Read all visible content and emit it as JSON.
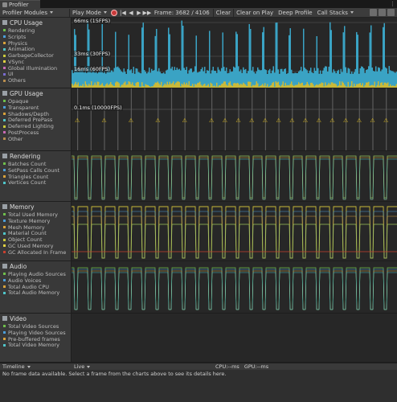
{
  "window": {
    "tab_label": "Profiler",
    "menu_glyph": "⋮"
  },
  "toolbar": {
    "modules_label": "Profiler Modules",
    "playmode_label": "Play Mode",
    "frame_label": "Frame: 3682 / 4106",
    "clear_label": "Clear",
    "clear_on_play_label": "Clear on Play",
    "deep_profile_label": "Deep Profile",
    "call_stacks_label": "Call Stacks",
    "prev_glyph": "◀",
    "next_glyph": "▶",
    "first_glyph": "|◀",
    "last_glyph": "▶▶"
  },
  "modules": [
    {
      "title": "CPU Usage",
      "icon": "cpu-icon",
      "items": [
        {
          "label": "Rendering",
          "color": "#6fbf4c"
        },
        {
          "label": "Scripts",
          "color": "#4c9ed9"
        },
        {
          "label": "Physics",
          "color": "#d9a23a"
        },
        {
          "label": "Animation",
          "color": "#4fc5c9"
        },
        {
          "label": "GarbageCollector",
          "color": "#c9c93c"
        },
        {
          "label": "VSync",
          "color": "#e0d142"
        },
        {
          "label": "Global Illumination",
          "color": "#c96ab5"
        },
        {
          "label": "UI",
          "color": "#7a6ccf"
        },
        {
          "label": "Others",
          "color": "#b88d4e"
        }
      ]
    },
    {
      "title": "GPU Usage",
      "icon": "gpu-icon",
      "items": [
        {
          "label": "Opaque",
          "color": "#6fbf4c"
        },
        {
          "label": "Transparent",
          "color": "#4c9ed9"
        },
        {
          "label": "Shadows/Depth",
          "color": "#d9a23a"
        },
        {
          "label": "Deferred PrePass",
          "color": "#4fc5c9"
        },
        {
          "label": "Deferred Lighting",
          "color": "#c9c93c"
        },
        {
          "label": "PostProcess",
          "color": "#c96ab5"
        },
        {
          "label": "Other",
          "color": "#b88d4e"
        }
      ]
    },
    {
      "title": "Rendering",
      "icon": "rendering-icon",
      "items": [
        {
          "label": "Batches Count",
          "color": "#6fbf4c"
        },
        {
          "label": "SetPass Calls Count",
          "color": "#4c9ed9"
        },
        {
          "label": "Triangles Count",
          "color": "#d9a23a"
        },
        {
          "label": "Vertices Count",
          "color": "#4fc5c9"
        }
      ]
    },
    {
      "title": "Memory",
      "icon": "memory-icon",
      "items": [
        {
          "label": "Total Used Memory",
          "color": "#6fbf4c"
        },
        {
          "label": "Texture Memory",
          "color": "#4c9ed9"
        },
        {
          "label": "Mesh Memory",
          "color": "#d9a23a"
        },
        {
          "label": "Material Count",
          "color": "#4fc5c9"
        },
        {
          "label": "Object Count",
          "color": "#c9c93c"
        },
        {
          "label": "GC Used Memory",
          "color": "#e0d142"
        },
        {
          "label": "GC Allocated In Frame",
          "color": "#c9412f"
        }
      ]
    },
    {
      "title": "Audio",
      "icon": "audio-icon",
      "items": [
        {
          "label": "Playing Audio Sources",
          "color": "#6fbf4c"
        },
        {
          "label": "Audio Voices",
          "color": "#4c9ed9"
        },
        {
          "label": "Total Audio CPU",
          "color": "#d9a23a"
        },
        {
          "label": "Total Audio Memory",
          "color": "#4fc5c9"
        }
      ]
    },
    {
      "title": "Video",
      "icon": "video-icon",
      "items": [
        {
          "label": "Total Video Sources",
          "color": "#6fbf4c"
        },
        {
          "label": "Playing Video Sources",
          "color": "#4c9ed9"
        },
        {
          "label": "Pre-buffered frames",
          "color": "#d9a23a"
        },
        {
          "label": "Total Video Memory",
          "color": "#4fc5c9"
        }
      ]
    }
  ],
  "cpu_chart": {
    "label_66": "66ms (15FPS)",
    "label_33": "33ms (30FPS)",
    "label_16": "16ms (60FPS)"
  },
  "gpu_chart": {
    "label_01": "0.1ms (10000FPS)",
    "warning_glyph": "⚠"
  },
  "timeline": {
    "view_label": "Timeline",
    "live_label": "Live",
    "cpu_label": "CPU:--ms",
    "gpu_label": "GPU:--ms"
  },
  "details": {
    "message": "No frame data available. Select a frame from the charts above to see its details here."
  }
}
